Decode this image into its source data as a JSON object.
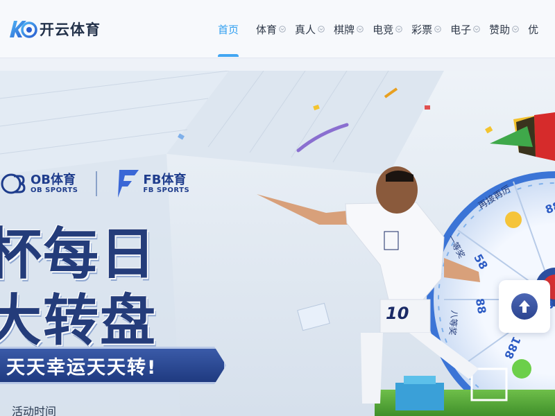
{
  "header": {
    "logo_text": "开云体育",
    "nav": [
      {
        "label": "首页",
        "active": true,
        "has_dropdown": false
      },
      {
        "label": "体育",
        "active": false,
        "has_dropdown": true
      },
      {
        "label": "真人",
        "active": false,
        "has_dropdown": true
      },
      {
        "label": "棋牌",
        "active": false,
        "has_dropdown": true
      },
      {
        "label": "电竞",
        "active": false,
        "has_dropdown": true
      },
      {
        "label": "彩票",
        "active": false,
        "has_dropdown": true
      },
      {
        "label": "电子",
        "active": false,
        "has_dropdown": true
      },
      {
        "label": "赞助",
        "active": false,
        "has_dropdown": true
      },
      {
        "label": "优",
        "active": false,
        "has_dropdown": false
      }
    ],
    "accent_color": "#2f9ef0"
  },
  "banner": {
    "partners": [
      {
        "name": "OB体育",
        "sub": "OB SPORTS"
      },
      {
        "name": "FB体育",
        "sub": "FB SPORTS"
      }
    ],
    "title_line1": "杯每日",
    "title_line2": "大转盘",
    "slogan": "天天幸运天天转!",
    "activity_time_label": "活动时间",
    "player_jersey_number": "10",
    "wheel_labels": [
      "再接再厉",
      "88",
      "58",
      "88",
      "188",
      "一等奖",
      "八等奖",
      "8"
    ]
  },
  "scroll_top": {
    "icon": "arrow-up-icon"
  }
}
